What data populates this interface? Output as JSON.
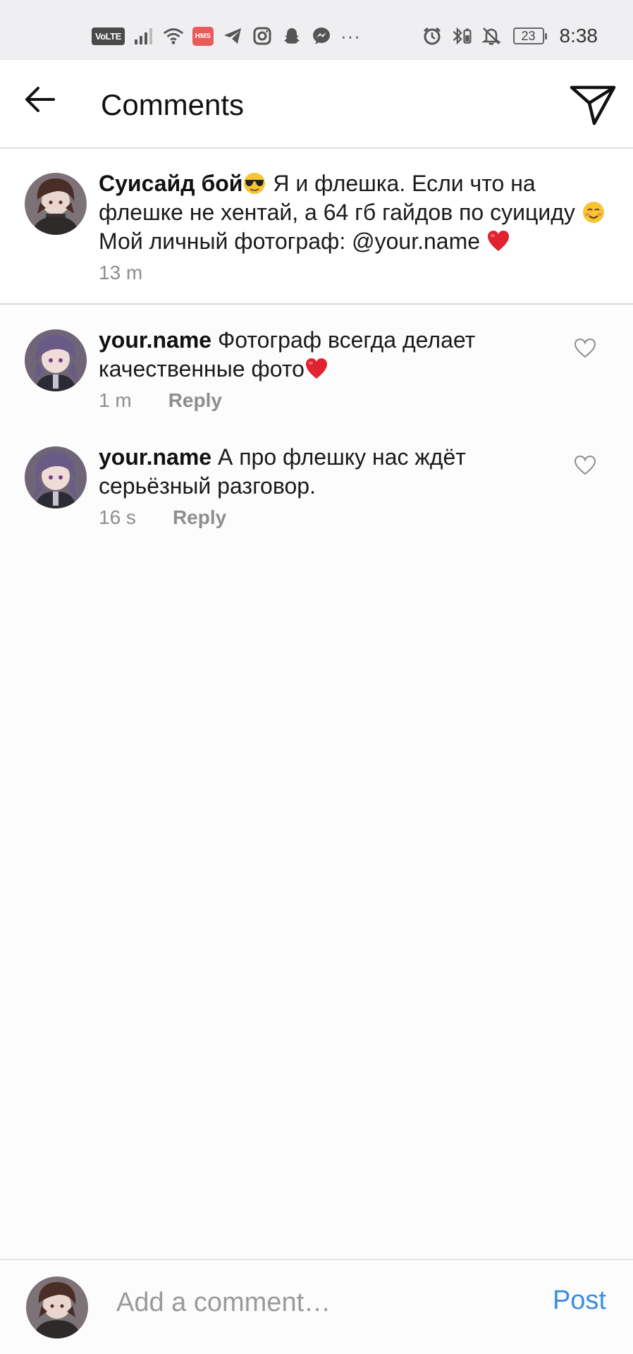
{
  "status_bar": {
    "volte": "VoLTE",
    "hms": "HMS",
    "battery": "23",
    "time": "8:38",
    "more": "···"
  },
  "header": {
    "title": "Comments"
  },
  "caption": {
    "username": "Суисайд бой",
    "text_1": " Я и флешка. Если что на флешке не хентай, а 64 гб гайдов по суициду ",
    "text_2": " Мой личный фотограф: @your.name ",
    "time": "13 m"
  },
  "comments": [
    {
      "username": "your.name",
      "text": " Фотограф всегда делает качественные фото",
      "time": "1 m",
      "reply": "Reply"
    },
    {
      "username": "your.name",
      "text": " А про флешку нас ждёт серьёзный разговор.",
      "time": "16 s",
      "reply": "Reply"
    }
  ],
  "composer": {
    "placeholder": "Add a comment…",
    "post_label": "Post"
  },
  "colors": {
    "accent": "#3b8ee0",
    "heart": "#e0232f",
    "muted": "#8e8e8e"
  }
}
